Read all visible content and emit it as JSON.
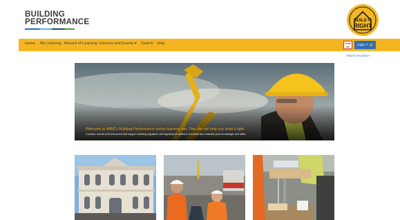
{
  "brand": {
    "line1": "BUILDING",
    "line2": "PERFORMANCE"
  },
  "logo": {
    "line1": "BUILD IT",
    "line2": "RIGHT"
  },
  "nav": {
    "items": [
      {
        "label": "Home"
      },
      {
        "label": "My Learning"
      },
      {
        "label": "Record of Learning"
      },
      {
        "label": "Courses and Events ▾"
      },
      {
        "label": "Search"
      },
      {
        "label": "Help"
      }
    ],
    "readme_badge": "Read me",
    "login_label": "Login ↗ 🔒",
    "whats_readme": "What's ReadMe?"
  },
  "hero": {
    "title": "Welcome to MBIE's Building Performance online learning site. This site will help you build it right",
    "subtitle": "Courses, events and resources that support building regulation will regularly be added to increase and maintain your knowledge and skills."
  },
  "colors": {
    "accent": "#f4b521",
    "login": "#2f6fb5",
    "hero_title": "#e8a82a"
  },
  "icons": [
    "lock-icon",
    "external-link-icon",
    "chevron-down-icon"
  ]
}
